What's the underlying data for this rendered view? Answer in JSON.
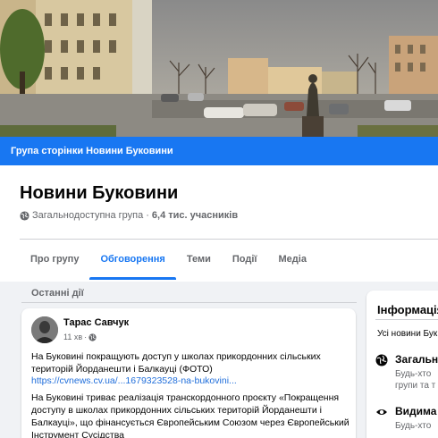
{
  "banner": {
    "label": "Група сторінки Новини Буковини"
  },
  "group": {
    "name": "Новини Буковини",
    "privacy": "Загальнодоступна група",
    "separator": "·",
    "members": "6,4 тис. учасників"
  },
  "tabs": [
    {
      "label": "Про групу",
      "active": false
    },
    {
      "label": "Обговорення",
      "active": true
    },
    {
      "label": "Теми",
      "active": false
    },
    {
      "label": "Події",
      "active": false
    },
    {
      "label": "Медіа",
      "active": false
    }
  ],
  "feed": {
    "section_label": "Останні дії"
  },
  "post": {
    "author": "Тарас Савчук",
    "time": "11 хв",
    "time_sep": "·",
    "more": "···",
    "text1": "На Буковині покращують доступ у школах прикордонних сільських територій Йорданешти і Балкауці (ФОТО)",
    "link": "https://cvnews.cv.ua/...1679323528-na-bukovini...",
    "text2": "На Буковині триває реалізація транскордонного проєкту «Покращення доступу в школах прикордонних сільських територій Йорданешти і Балкауці», що фінансується Європейським Союзом через Європейський Інструмент Сусідства"
  },
  "info": {
    "title": "Інформація",
    "desc": "Усі новини Бук",
    "items": [
      {
        "icon": "globe-icon",
        "heading": "Загальн",
        "sub": "Будь-хто",
        "sub2": "групи та т"
      },
      {
        "icon": "eye-icon",
        "heading": "Видима",
        "sub": "Будь-хто"
      }
    ]
  },
  "colors": {
    "accent": "#1877f2",
    "background": "#f0f2f5",
    "secondary_text": "#65676b"
  }
}
